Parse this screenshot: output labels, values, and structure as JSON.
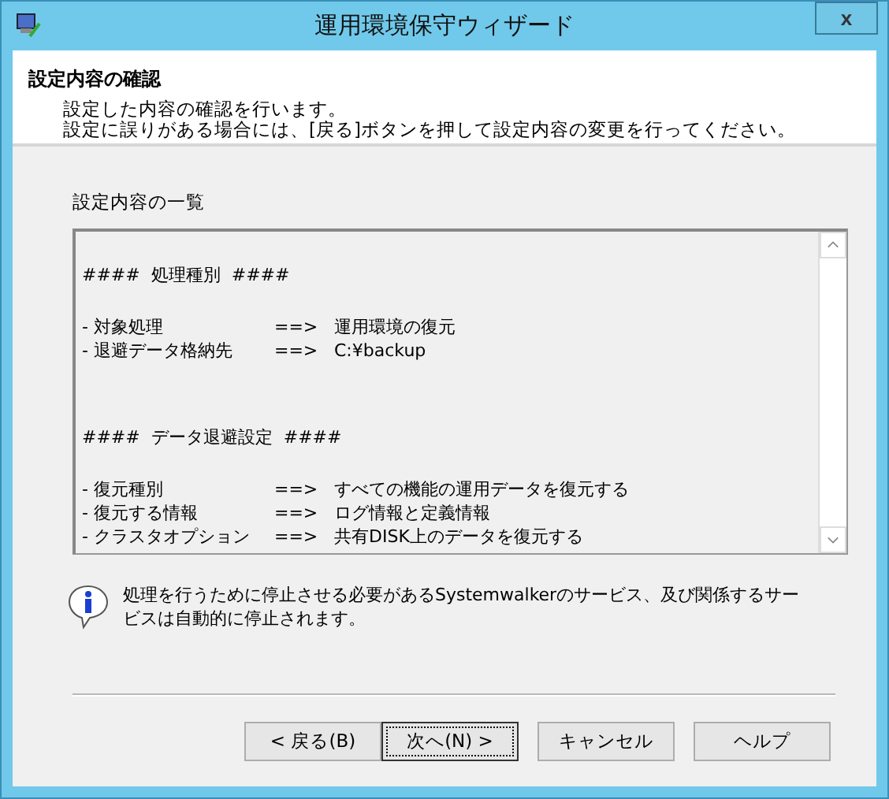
{
  "window": {
    "title": "運用環境保守ウィザード",
    "close": "x"
  },
  "header": {
    "title": "設定内容の確認",
    "lines": [
      "設定した内容の確認を行います。",
      "設定に誤りがある場合には、[戻る]ボタンを押して設定内容の変更を行ってください。"
    ]
  },
  "summary": {
    "label": "設定内容の一覧",
    "sections": [
      {
        "heading": "####  処理種別  ####",
        "entries": [
          {
            "label": "- 対象処理",
            "arrow": "==>",
            "value": "運用環境の復元"
          },
          {
            "label": "- 退避データ格納先",
            "arrow": "==>",
            "value": "C:¥backup"
          }
        ]
      },
      {
        "heading": "####  データ退避設定  ####",
        "entries": [
          {
            "label": "- 復元種別",
            "arrow": "==>",
            "value": "すべての機能の運用データを復元する"
          },
          {
            "label": "- 復元する情報",
            "arrow": "==>",
            "value": "ログ情報と定義情報"
          },
          {
            "label": "- クラスタオプション",
            "arrow": "==>",
            "value": "共有DISK上のデータを復元する"
          }
        ]
      }
    ]
  },
  "info": "処理を行うために停止させる必要があるSystemwalkerのサービス、及び関係するサービスは自動的に停止されます。",
  "buttons": [
    {
      "label": "< 戻る(B)",
      "default": false
    },
    {
      "label": "次へ(N) >",
      "default": true
    },
    {
      "label": "キャンセル",
      "default": false
    },
    {
      "label": "ヘルプ",
      "default": false
    }
  ]
}
